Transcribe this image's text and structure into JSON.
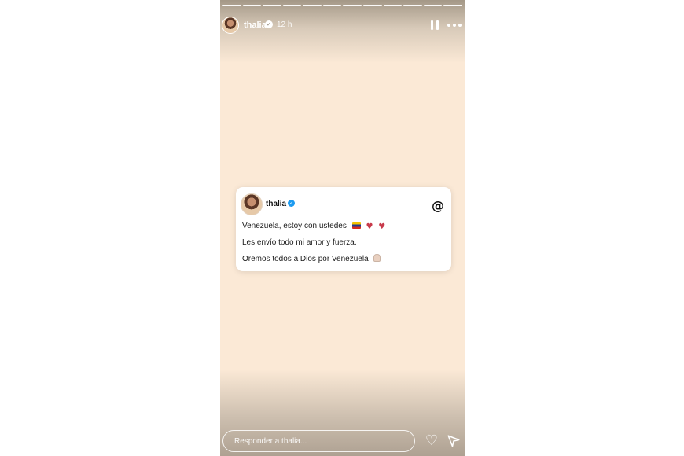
{
  "story": {
    "username": "thalia",
    "time": "12 h",
    "progress_segments": 12,
    "active_segment": 11
  },
  "post": {
    "username": "thalia",
    "line1": "Venezuela, estoy con ustedes",
    "line2": "Les envío todo mi amor y fuerza.",
    "line3": "Oremos todos a Dios por Venezuela"
  },
  "reply": {
    "placeholder": "Responder a thalia..."
  },
  "icons": {
    "pause": "pause-icon",
    "more": "more-icon",
    "threads": "threads-logo-icon",
    "like": "heart-icon",
    "send": "send-icon"
  },
  "colors": {
    "background": "#fbe9d6",
    "verified_badge": "#1d9bf0",
    "flag_yellow": "#f5c300",
    "flag_blue": "#1f3a93",
    "flag_red": "#d52b1e"
  }
}
